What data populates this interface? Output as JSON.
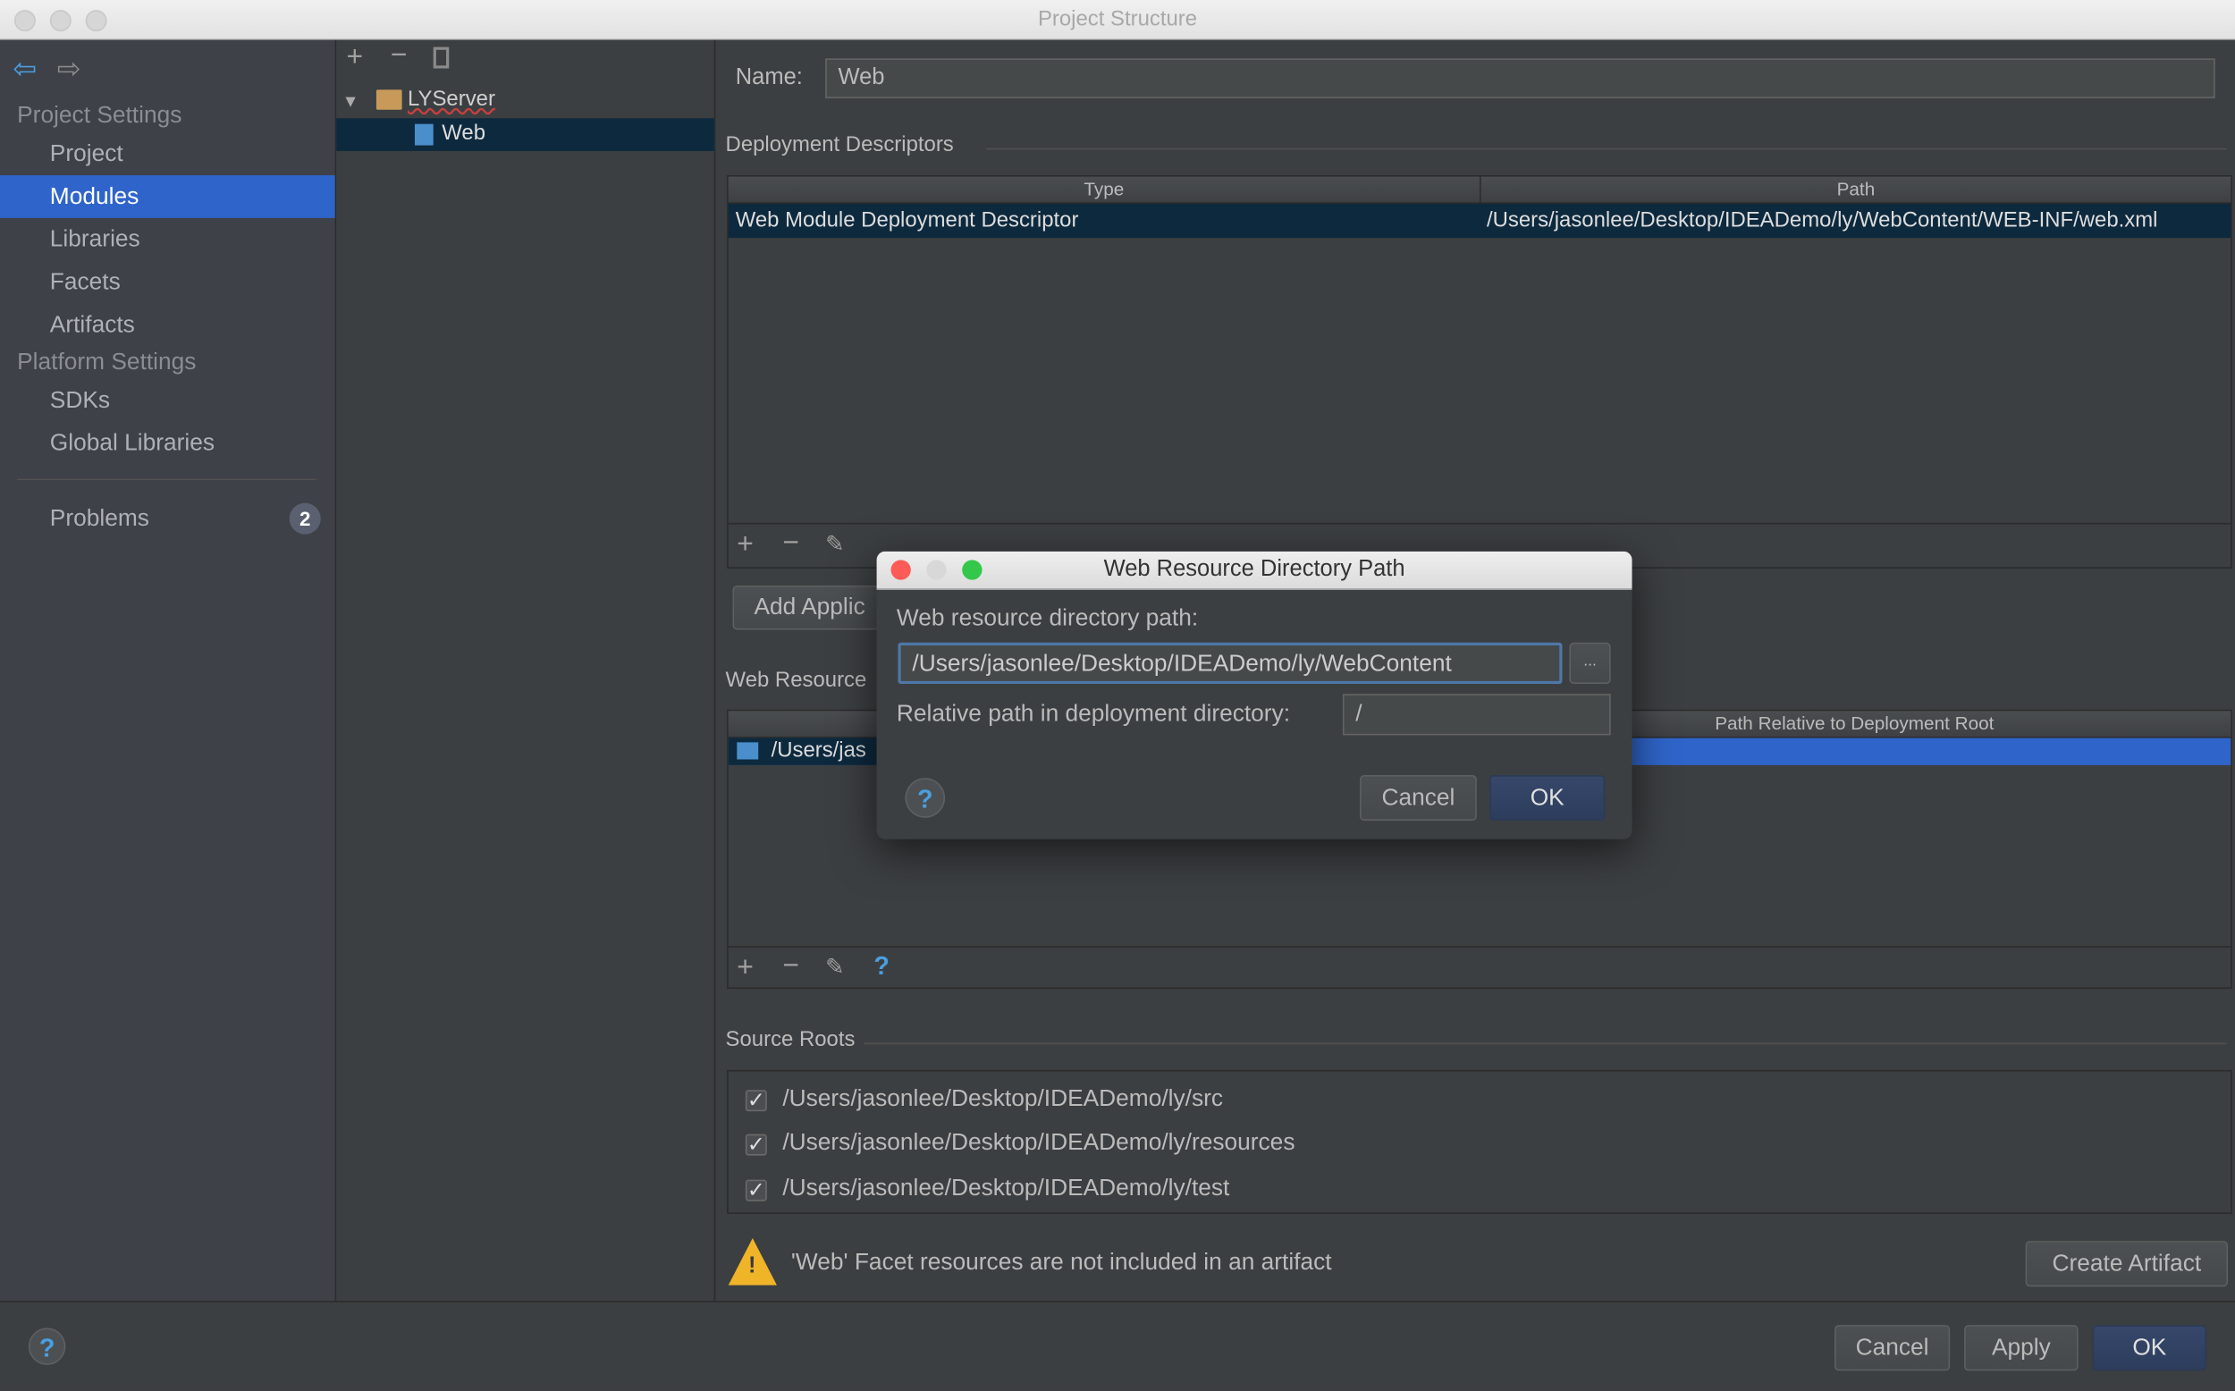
{
  "window": {
    "title": "Project Structure"
  },
  "sidebar": {
    "project_settings": "Project Settings",
    "items": [
      {
        "label": "Project"
      },
      {
        "label": "Modules"
      },
      {
        "label": "Libraries"
      },
      {
        "label": "Facets"
      },
      {
        "label": "Artifacts"
      }
    ],
    "platform_settings": "Platform Settings",
    "platform_items": [
      {
        "label": "SDKs"
      },
      {
        "label": "Global Libraries"
      }
    ],
    "problems": {
      "label": "Problems",
      "count": "2"
    },
    "selected": "Modules"
  },
  "tree": {
    "root": "LYServer",
    "child": "Web"
  },
  "details": {
    "name_label": "Name:",
    "name_value": "Web",
    "deployment_descriptors": {
      "heading": "Deployment Descriptors",
      "columns": [
        "Type",
        "Path"
      ],
      "rows": [
        {
          "type": "Web Module Deployment Descriptor",
          "path": "/Users/jasonlee/Desktop/IDEADemo/ly/WebContent/WEB-INF/web.xml"
        }
      ]
    },
    "add_button": "Add Applic",
    "web_resource": {
      "heading": "Web Resource",
      "column": "Path Relative to Deployment Root",
      "row_path": "/Users/jas"
    },
    "source_roots": {
      "heading": "Source Roots",
      "items": [
        {
          "path": "/Users/jasonlee/Desktop/IDEADemo/ly/src",
          "checked": true
        },
        {
          "path": "/Users/jasonlee/Desktop/IDEADemo/ly/resources",
          "checked": true
        },
        {
          "path": "/Users/jasonlee/Desktop/IDEADemo/ly/test",
          "checked": true
        }
      ]
    },
    "warning": "'Web' Facet resources are not included in an artifact",
    "create_artifact": "Create Artifact"
  },
  "footer": {
    "help": "?",
    "cancel": "Cancel",
    "apply": "Apply",
    "ok": "OK"
  },
  "dialog": {
    "title": "Web Resource Directory Path",
    "path_label": "Web resource directory path:",
    "path_value": "/Users/jasonlee/Desktop/IDEADemo/ly/WebContent",
    "browse": "...",
    "relative_label": "Relative path in deployment directory:",
    "relative_value": "/",
    "help": "?",
    "cancel": "Cancel",
    "ok": "OK"
  },
  "colors": {
    "selection": "#2f65ca",
    "selection_inactive": "#0d293e",
    "background": "#3c3f41",
    "help": "#4a9fe0"
  }
}
